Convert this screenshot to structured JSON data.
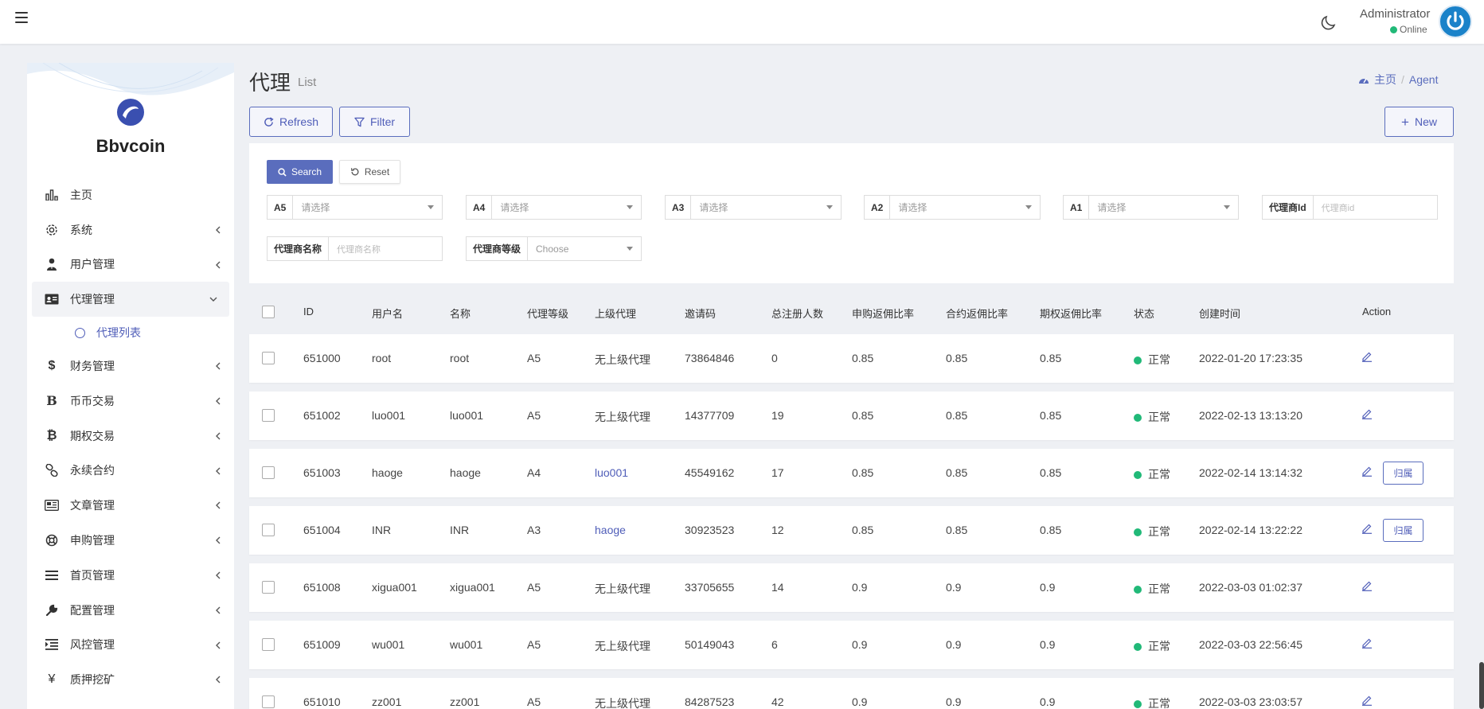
{
  "header": {
    "user_name": "Administrator",
    "user_status": "Online"
  },
  "sidebar": {
    "brand": "Bbvcoin",
    "items": [
      {
        "label": "主页",
        "icon": "bar-chart-icon",
        "has_children": false
      },
      {
        "label": "系统",
        "icon": "gear-icon",
        "has_children": true
      },
      {
        "label": "用户管理",
        "icon": "user-tie-icon",
        "has_children": true
      },
      {
        "label": "代理管理",
        "icon": "id-card-icon",
        "has_children": true,
        "expanded": true
      },
      {
        "label": "财务管理",
        "icon": "dollar-icon",
        "has_children": true
      },
      {
        "label": "币币交易",
        "icon": "bitcoin-b-icon",
        "has_children": true
      },
      {
        "label": "期权交易",
        "icon": "bitcoin-icon",
        "has_children": true
      },
      {
        "label": "永续合约",
        "icon": "link-icon",
        "has_children": true
      },
      {
        "label": "文章管理",
        "icon": "newspaper-icon",
        "has_children": true
      },
      {
        "label": "申购管理",
        "icon": "life-ring-icon",
        "has_children": true
      },
      {
        "label": "首页管理",
        "icon": "list-icon",
        "has_children": true
      },
      {
        "label": "配置管理",
        "icon": "wrench-icon",
        "has_children": true
      },
      {
        "label": "风控管理",
        "icon": "indent-icon",
        "has_children": true
      },
      {
        "label": "质押挖矿",
        "icon": "yen-icon",
        "has_children": true
      }
    ],
    "sub_item": "代理列表"
  },
  "page": {
    "title": "代理",
    "subtitle": "List",
    "breadcrumb_home": "主页",
    "breadcrumb_sep": "/",
    "breadcrumb_current": "Agent"
  },
  "toolbar": {
    "refresh_label": "Refresh",
    "filter_label": "Filter",
    "new_label": "New"
  },
  "filter": {
    "search_label": "Search",
    "reset_label": "Reset",
    "fields": [
      {
        "label": "A5",
        "placeholder": "请选择"
      },
      {
        "label": "A4",
        "placeholder": "请选择"
      },
      {
        "label": "A3",
        "placeholder": "请选择"
      },
      {
        "label": "A2",
        "placeholder": "请选择"
      },
      {
        "label": "A1",
        "placeholder": "请选择"
      },
      {
        "label": "代理商Id",
        "placeholder": "代理商id"
      },
      {
        "label": "代理商名称",
        "placeholder": "代理商名称"
      },
      {
        "label": "代理商等级",
        "placeholder": "Choose"
      }
    ]
  },
  "table": {
    "columns": [
      "ID",
      "用户名",
      "名称",
      "代理等级",
      "上级代理",
      "邀请码",
      "总注册人数",
      "申购返佣比率",
      "合约返佣比率",
      "期权返佣比率",
      "状态",
      "创建时间",
      "Action"
    ],
    "belong_label": "归属",
    "rows": [
      {
        "id": "651000",
        "username": "root",
        "name": "root",
        "level": "A5",
        "parent": "无上级代理",
        "parent_link": false,
        "invite": "73864846",
        "count": "0",
        "r1": "0.85",
        "r2": "0.85",
        "r3": "0.85",
        "status": "正常",
        "created": "2022-01-20 17:23:35",
        "belong": false
      },
      {
        "id": "651002",
        "username": "luo001",
        "name": "luo001",
        "level": "A5",
        "parent": "无上级代理",
        "parent_link": false,
        "invite": "14377709",
        "count": "19",
        "r1": "0.85",
        "r2": "0.85",
        "r3": "0.85",
        "status": "正常",
        "created": "2022-02-13 13:13:20",
        "belong": false
      },
      {
        "id": "651003",
        "username": "haoge",
        "name": "haoge",
        "level": "A4",
        "parent": "luo001",
        "parent_link": true,
        "invite": "45549162",
        "count": "17",
        "r1": "0.85",
        "r2": "0.85",
        "r3": "0.85",
        "status": "正常",
        "created": "2022-02-14 13:14:32",
        "belong": true
      },
      {
        "id": "651004",
        "username": "INR",
        "name": "INR",
        "level": "A3",
        "parent": "haoge",
        "parent_link": true,
        "invite": "30923523",
        "count": "12",
        "r1": "0.85",
        "r2": "0.85",
        "r3": "0.85",
        "status": "正常",
        "created": "2022-02-14 13:22:22",
        "belong": true
      },
      {
        "id": "651008",
        "username": "xigua001",
        "name": "xigua001",
        "level": "A5",
        "parent": "无上级代理",
        "parent_link": false,
        "invite": "33705655",
        "count": "14",
        "r1": "0.9",
        "r2": "0.9",
        "r3": "0.9",
        "status": "正常",
        "created": "2022-03-03 01:02:37",
        "belong": false
      },
      {
        "id": "651009",
        "username": "wu001",
        "name": "wu001",
        "level": "A5",
        "parent": "无上级代理",
        "parent_link": false,
        "invite": "50149043",
        "count": "6",
        "r1": "0.9",
        "r2": "0.9",
        "r3": "0.9",
        "status": "正常",
        "created": "2022-03-03 22:56:45",
        "belong": false
      },
      {
        "id": "651010",
        "username": "zz001",
        "name": "zz001",
        "level": "A5",
        "parent": "无上级代理",
        "parent_link": false,
        "invite": "84287523",
        "count": "42",
        "r1": "0.9",
        "r2": "0.9",
        "r3": "0.9",
        "status": "正常",
        "created": "2022-03-03 23:03:57",
        "belong": false
      }
    ]
  },
  "colors": {
    "accent": "#5a6dbd",
    "status_ok": "#21b978",
    "background": "#eef0f4"
  }
}
